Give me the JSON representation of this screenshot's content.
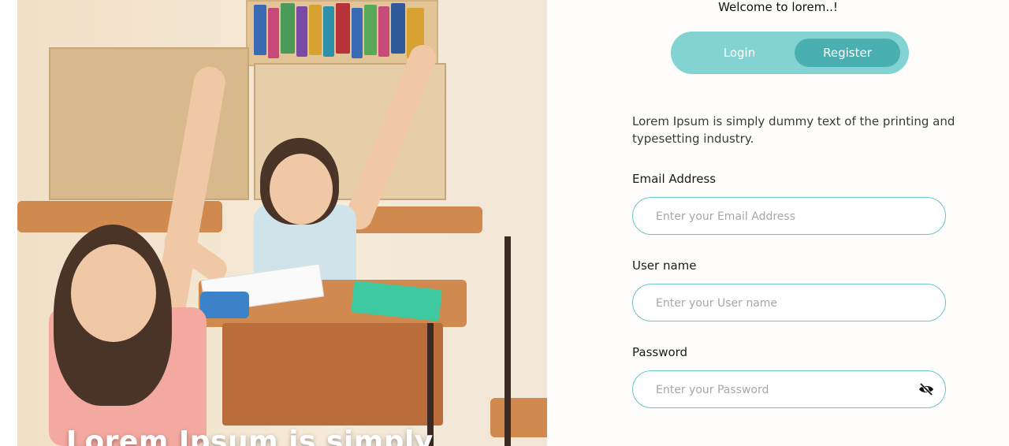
{
  "hero": {
    "overlay_text": "Lorem Ipsum is simply"
  },
  "auth": {
    "welcome": "Welcome to lorem..!",
    "tabs": {
      "login": "Login",
      "register": "Register",
      "active": "register"
    },
    "description": "Lorem Ipsum is simply dummy text of the printing and typesetting industry.",
    "fields": {
      "email": {
        "label": "Email Address",
        "placeholder": "Enter your Email Address"
      },
      "username": {
        "label": "User name",
        "placeholder": "Enter your User name"
      },
      "password": {
        "label": "Password",
        "placeholder": "Enter your Password",
        "icon": "eye-slash-icon"
      }
    }
  },
  "colors": {
    "toggle_bg": "#82d3d2",
    "toggle_active": "#4aafb0",
    "field_border": "#6cc4c6"
  }
}
